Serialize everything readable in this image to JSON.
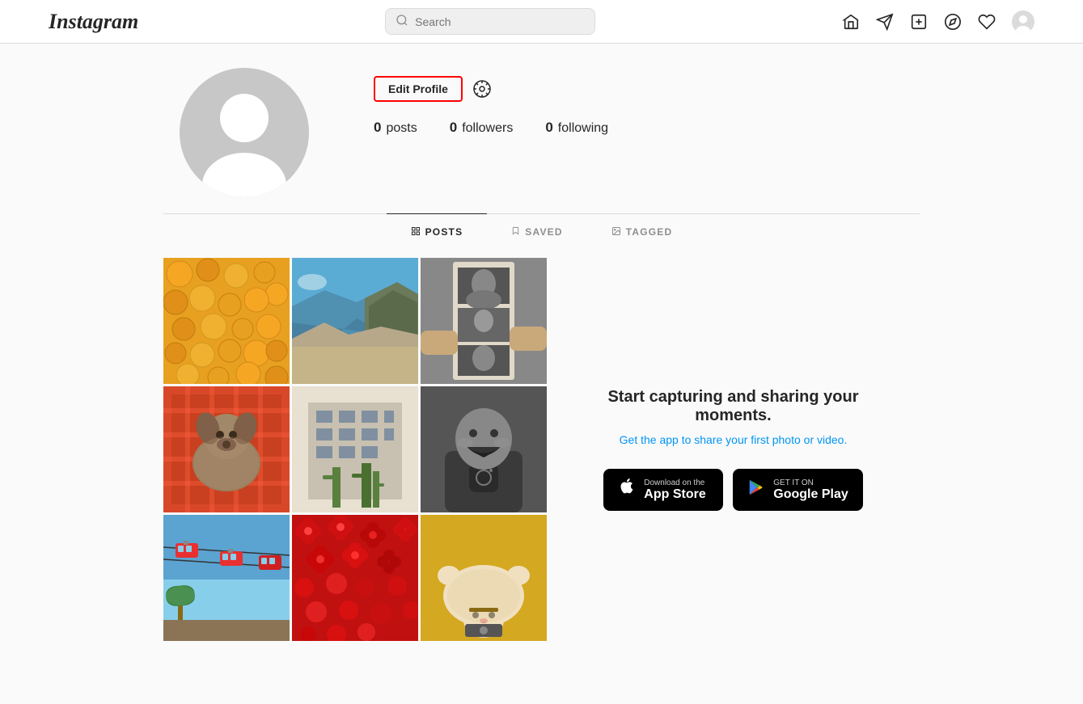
{
  "header": {
    "logo": "Instagram",
    "search_placeholder": "Search",
    "icons": {
      "home": "⌂",
      "send": "▷",
      "add": "⊕",
      "explore": "◎",
      "heart": "♡"
    }
  },
  "profile": {
    "edit_button": "Edit Profile",
    "stats": {
      "posts_count": "0",
      "posts_label": "posts",
      "followers_count": "0",
      "followers_label": "followers",
      "following_count": "0",
      "following_label": "following"
    }
  },
  "tabs": [
    {
      "id": "posts",
      "label": "POSTS",
      "active": true
    },
    {
      "id": "saved",
      "label": "SAVED",
      "active": false
    },
    {
      "id": "tagged",
      "label": "TAGGED",
      "active": false
    }
  ],
  "promo": {
    "title": "Start capturing and sharing your moments.",
    "subtitle": "Get the app to share your first photo or video.",
    "app_store_sub": "Download on the",
    "app_store_name": "App Store",
    "google_play_sub": "GET IT ON",
    "google_play_name": "Google Play"
  }
}
